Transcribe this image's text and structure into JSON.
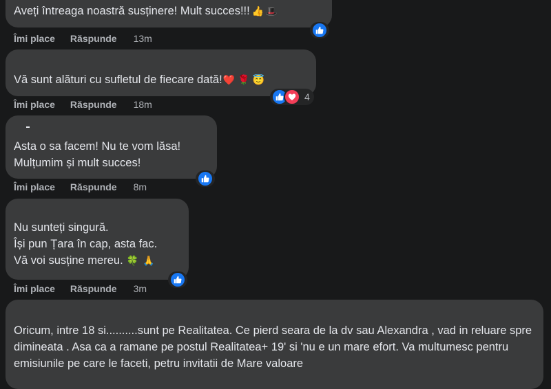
{
  "actions": {
    "like": "Îmi place",
    "reply": "Răspunde"
  },
  "comments": [
    {
      "lines": [
        "Aveți întreaga noastră susținere! Mult succes!!!"
      ],
      "emojis": [
        "thumbs-up",
        "top-hat"
      ],
      "time": "13m",
      "reactions": [
        "like"
      ]
    },
    {
      "lines": [
        "Vă sunt alături cu sufletul de fiecare dată!"
      ],
      "emojis": [
        "red-heart",
        "rose",
        "smiling-face-halo"
      ],
      "time": "18m",
      "reactions": [
        "like",
        "love"
      ],
      "reaction_count": "4"
    },
    {
      "lines": [
        "Asta o sa facem! Nu te vom lăsa!",
        "Mulțumim și mult succes!"
      ],
      "time": "8m",
      "reactions": [
        "like"
      ]
    },
    {
      "lines": [
        "Nu sunteți singură.",
        "Își pun Țara în cap, asta fac.",
        "Vă voi susține mereu."
      ],
      "emojis": [
        "four-leaf-clover",
        "folded-hands"
      ],
      "time": "3m",
      "reactions": [
        "like"
      ]
    },
    {
      "text": "Oricum, intre 18 si..........sunt pe Realitatea. Ce pierd seara de la dv sau Alexandra , vad in reluare spre dimineata . Asa ca a ramane pe postul Realitatea+ 19' si 'nu e un mare efort. Va multumesc pentru emisiunile pe care le faceti, petru invitatii de Mare valoare"
    }
  ],
  "colors": {
    "background": "#18191a",
    "bubble": "#3a3b3c",
    "text": "#e4e6eb",
    "secondary_text": "#b0b3b8",
    "like_blue": "#1877f2",
    "love_red": "#f33e58"
  }
}
